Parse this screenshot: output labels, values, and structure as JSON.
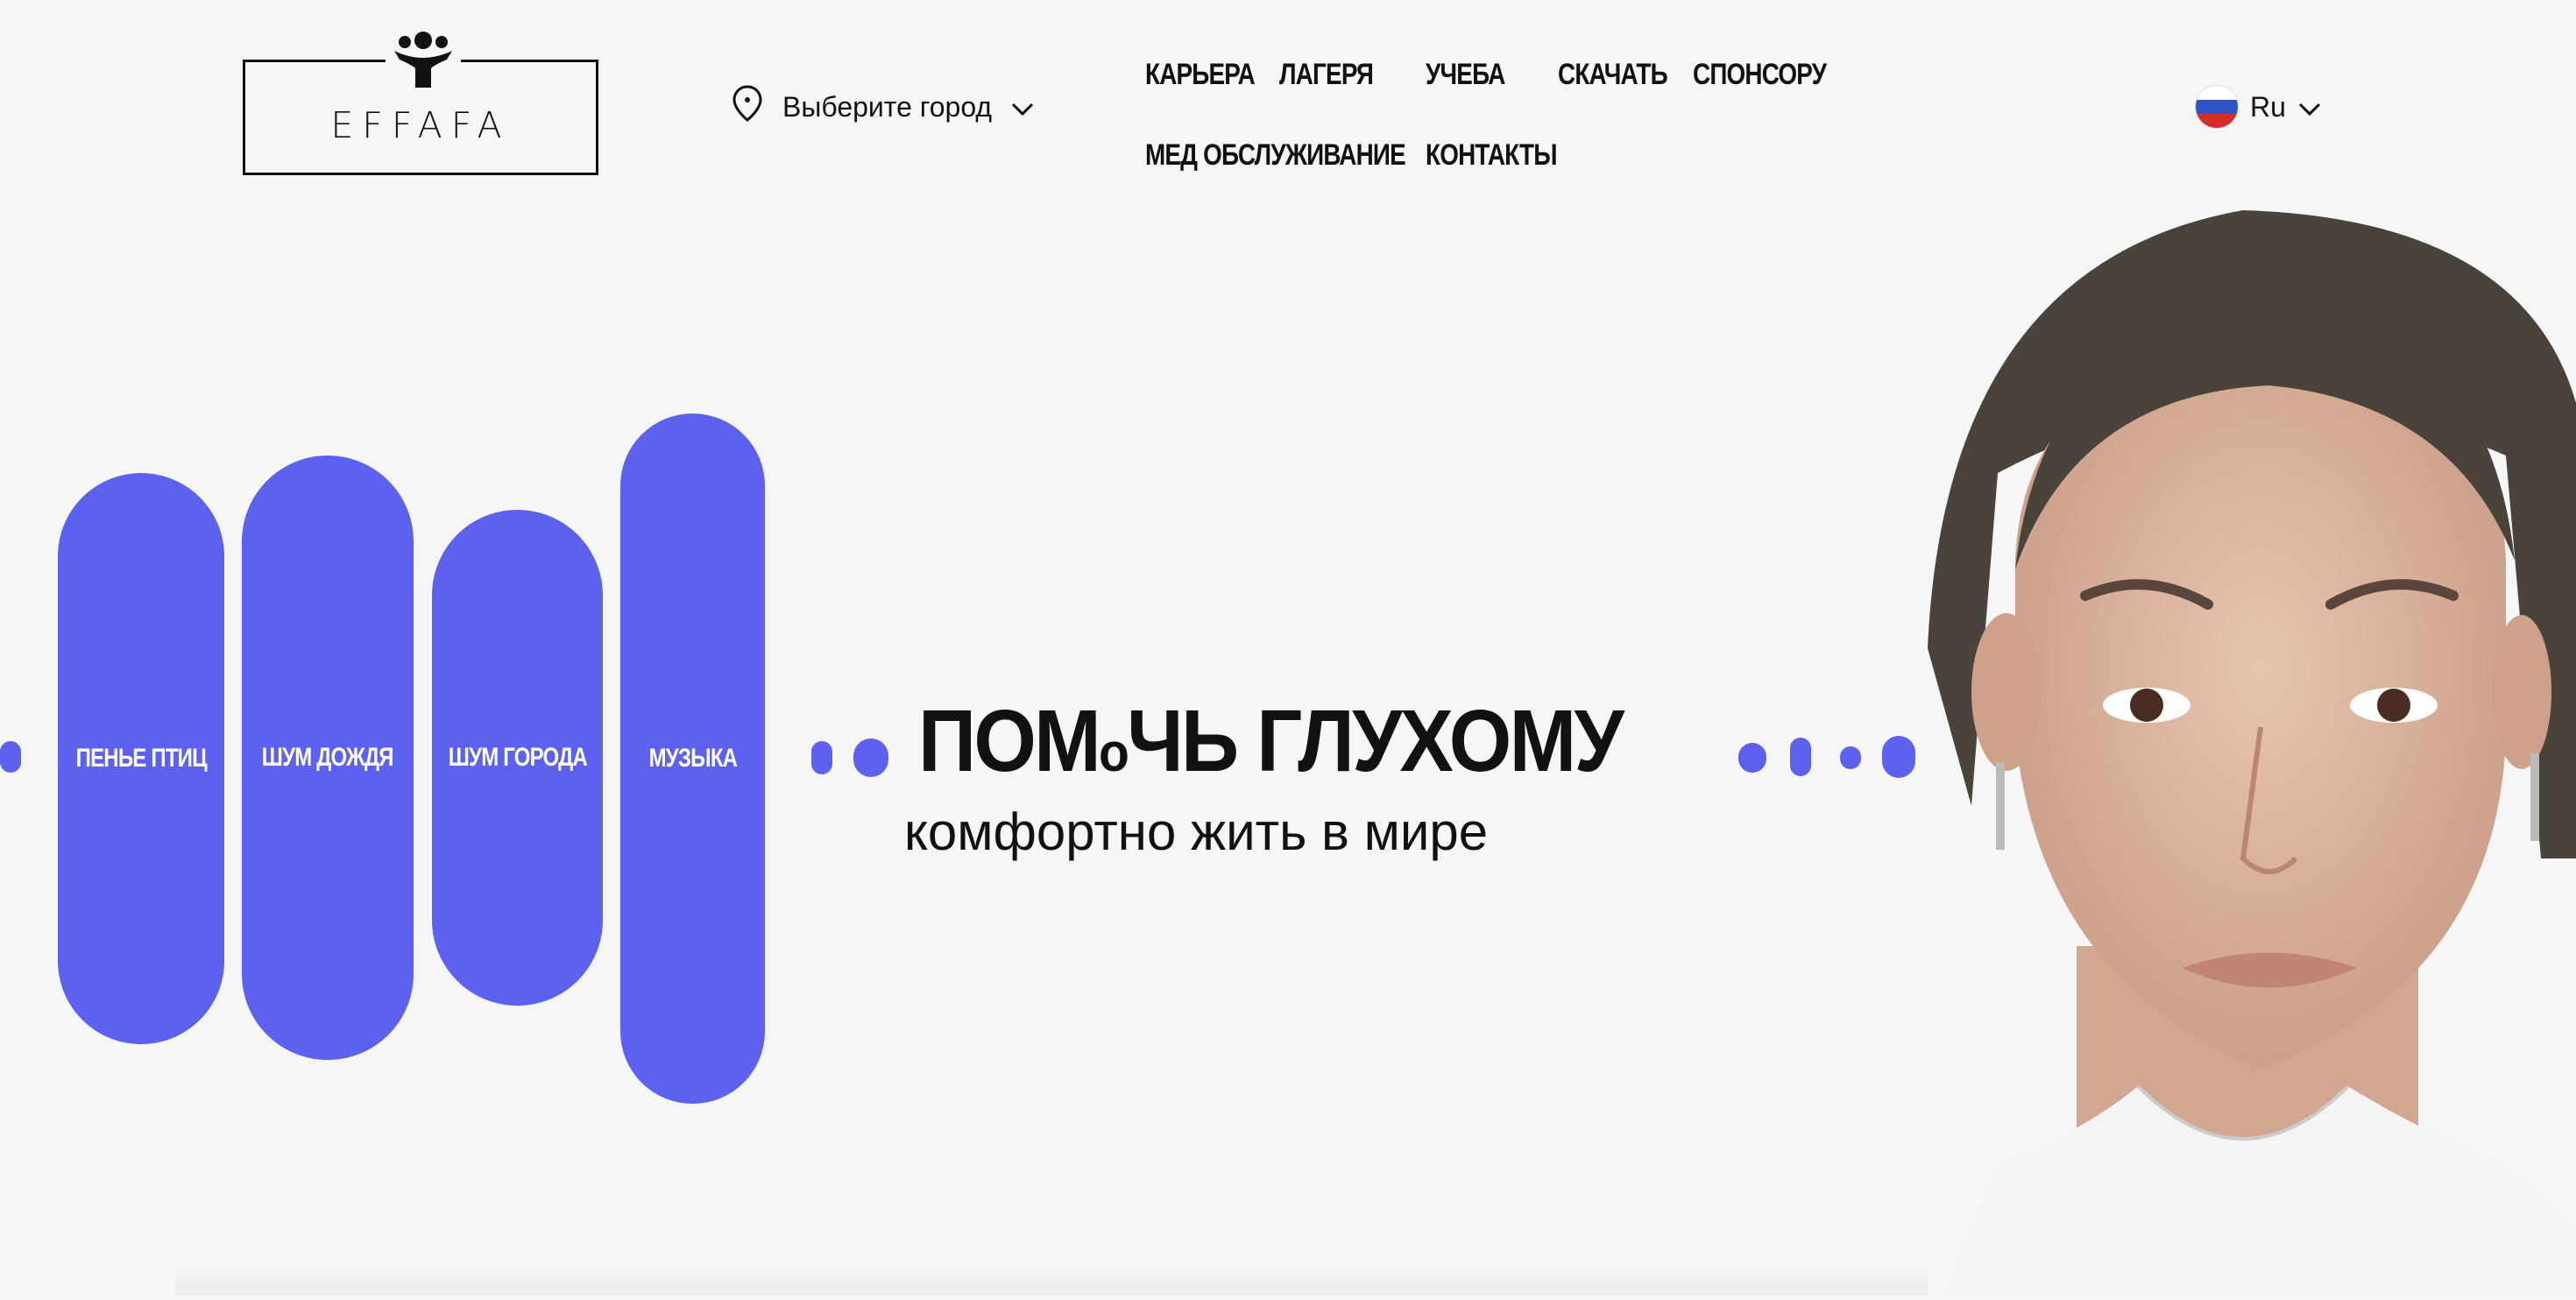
{
  "header": {
    "logo_text": "EFFAFA",
    "city_label": "Выберите город",
    "nav": [
      {
        "label": "КАРЬЕРА"
      },
      {
        "label": "ЛАГЕРЯ"
      },
      {
        "label": "УЧЕБА"
      },
      {
        "label": "СКАЧАТЬ"
      },
      {
        "label": "СПОНСОРУ"
      },
      {
        "label": "МЕД ОБСЛУЖИВАНИЕ"
      },
      {
        "label": "КОНТАКТЫ"
      }
    ],
    "language": "Ru"
  },
  "sound_pills": [
    {
      "label": "ПЕНЬЕ ПТИЦ"
    },
    {
      "label": "ШУМ ДОЖДЯ"
    },
    {
      "label": "ШУМ ГОРОДА"
    },
    {
      "label": "МУЗЫКА"
    }
  ],
  "hero": {
    "title_part1": "ПОМ",
    "title_o": "о",
    "title_part2": "ЧЬ ГЛУХОМУ",
    "subtitle": "комфортно жить в мире"
  },
  "colors": {
    "accent": "#5d61ef",
    "background": "#f6f6f6",
    "text": "#111111"
  }
}
